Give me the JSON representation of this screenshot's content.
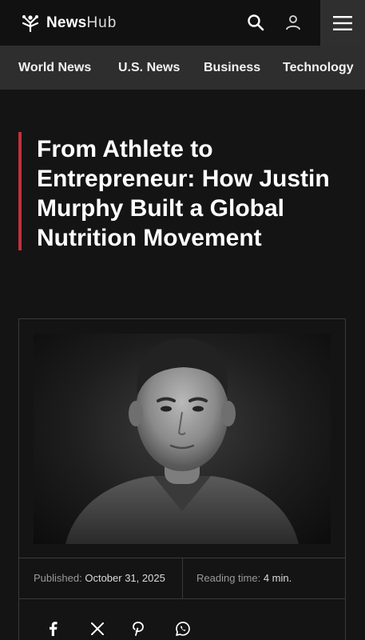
{
  "header": {
    "logo_news": "News",
    "logo_hub": "Hub",
    "icons": [
      "newshub-logo-icon",
      "search-icon",
      "user-icon",
      "hamburger-menu-icon"
    ]
  },
  "nav": {
    "items": [
      "World News",
      "U.S. News",
      "Business",
      "Technology"
    ]
  },
  "article": {
    "headline": "From Athlete to Entrepreneur: How Justin Murphy Built a Global Nutrition Movement",
    "published_label": "Published:",
    "published_date": "October 31, 2025",
    "reading_label": "Reading time:",
    "reading_value": "4 min."
  },
  "share": {
    "icons": [
      "facebook-icon",
      "x-icon",
      "pinterest-icon",
      "whatsapp-icon"
    ]
  },
  "colors": {
    "page_bg": "#141414",
    "topbar_bg": "#111111",
    "navbar_bg": "#2e2e2e",
    "menu_button_bg": "#2f2f2f",
    "accent": "#c0323c"
  }
}
